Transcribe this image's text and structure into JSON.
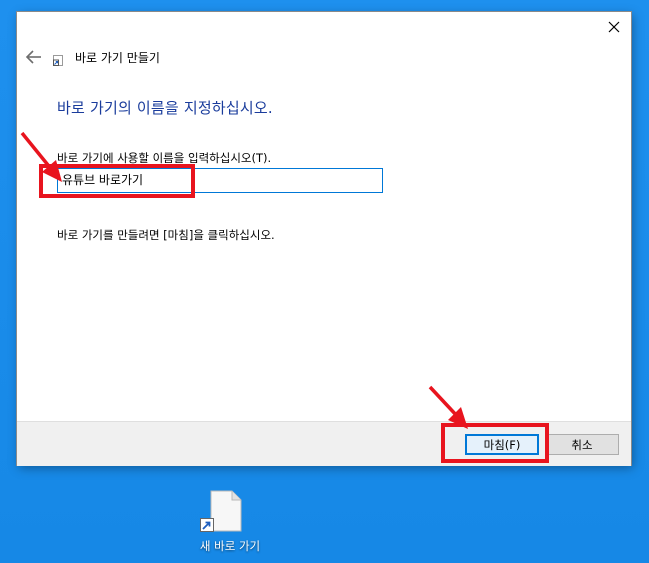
{
  "wizard": {
    "title": "바로 가기 만들기",
    "heading": "바로 가기의 이름을 지정하십시오.",
    "field_label": "바로 가기에 사용할 이름을 입력하십시오(T).",
    "name_value": "유튜브 바로가기",
    "finish_message": "바로 가기를 만들려면 [마침]을 클릭하십시오.",
    "finish_button": "마침(F)",
    "cancel_button": "취소",
    "icons": {
      "back": "back-arrow-icon",
      "close": "close-icon",
      "wizard": "shortcut-wizard-icon"
    }
  },
  "desktop": {
    "icon_label": "새 바로 가기",
    "icon": "shortcut-file-icon"
  },
  "annotations": {
    "highlight_color": "#e8141e"
  },
  "colors": {
    "desktop_bg": "#1a8be8",
    "heading": "#1a3c9c",
    "accent": "#0078d7"
  }
}
